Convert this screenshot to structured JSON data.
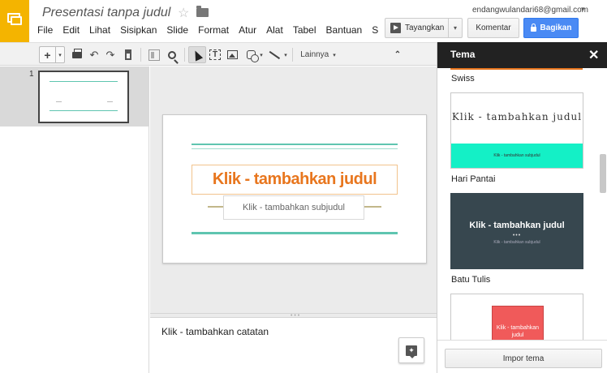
{
  "app": {
    "logo_icon": "slides-logo-icon",
    "brand_color": "#f4b400"
  },
  "document": {
    "title": "Presentasi tanpa judul"
  },
  "account": {
    "email": "endangwulandari68@gmail.com"
  },
  "menu": [
    "File",
    "Edit",
    "Lihat",
    "Sisipkan",
    "Slide",
    "Format",
    "Atur",
    "Alat",
    "Tabel",
    "Bantuan",
    "S"
  ],
  "header_buttons": {
    "present_label": "Tayangkan",
    "comments_label": "Komentar",
    "share_label": "Bagikan",
    "share_color": "#4a8af4"
  },
  "toolbar": {
    "new_slide_label": "+",
    "more_label": "Lainnya",
    "undo_glyph": "↶",
    "redo_glyph": "↷",
    "collapse_glyph": "⌃",
    "dropdown_glyph": "▾"
  },
  "filmstrip": {
    "slide_number": "1"
  },
  "slide": {
    "title_placeholder": "Klik - tambahkan judul",
    "subtitle_placeholder": "Klik - tambahkan subjudul",
    "title_color": "#e8761e",
    "accent_color": "#5fc5b0"
  },
  "notes": {
    "placeholder": "Klik - tambahkan catatan"
  },
  "theme_panel": {
    "title": "Tema",
    "close_glyph": "✕",
    "themes": [
      {
        "name": "Swiss",
        "preview_title": "Klik - tambahkan judul",
        "preview_subtitle": "Klik - tambahkan subjudul",
        "accent": "#14f0c6"
      },
      {
        "name": "Hari Pantai",
        "preview_title": "Klik - tambahkan judul",
        "preview_dots": "•••",
        "preview_subtitle": "Klik - tambahkan subjudul",
        "background": "#37474f"
      },
      {
        "name": "Batu Tulis",
        "preview_title": "Klik - tambahkan judul",
        "accent": "#f05a5a"
      }
    ],
    "import_label": "Impor tema"
  }
}
